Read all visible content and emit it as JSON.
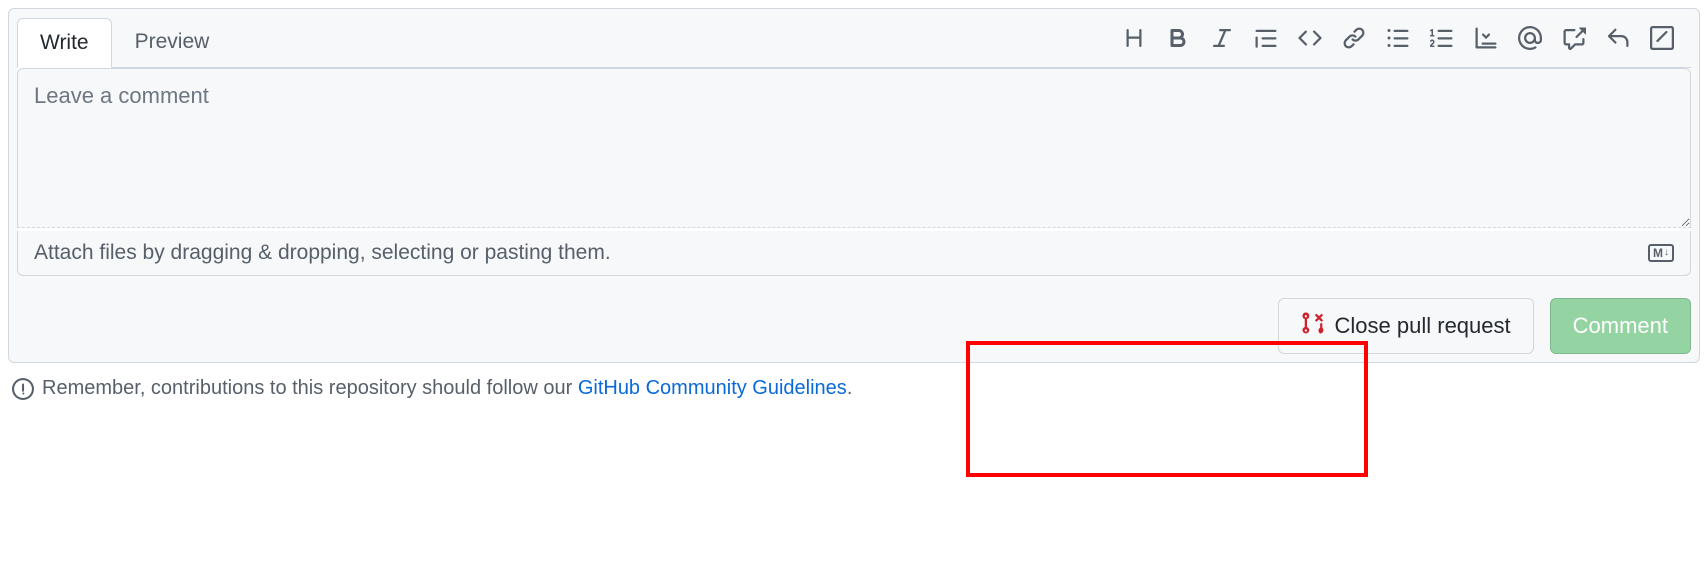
{
  "tabs": {
    "write": "Write",
    "preview": "Preview"
  },
  "textarea": {
    "placeholder": "Leave a comment",
    "value": ""
  },
  "attach_hint": "Attach files by dragging & dropping, selecting or pasting them.",
  "buttons": {
    "close": "Close pull request",
    "comment": "Comment"
  },
  "footer": {
    "prefix": "Remember, contributions to this repository should follow our ",
    "link": "GitHub Community Guidelines",
    "suffix": "."
  },
  "md_badge": "M"
}
